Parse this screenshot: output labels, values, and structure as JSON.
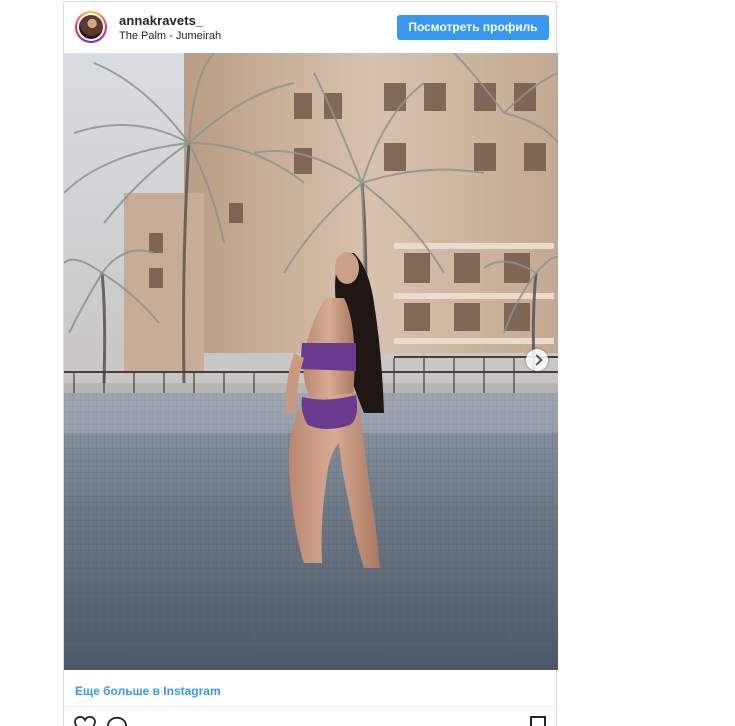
{
  "post": {
    "username": "annakravets_",
    "location": "The Palm - Jumeirah",
    "profile_button": "Посмотреть профиль",
    "more_link": "Еще больше в Instagram"
  },
  "icons": {
    "like": "heart-icon",
    "comment": "comment-icon",
    "save": "bookmark-icon",
    "next": "chevron-right-icon"
  },
  "colors": {
    "accent": "#3897f0",
    "text": "#262626",
    "border": "#dbdbdb"
  }
}
